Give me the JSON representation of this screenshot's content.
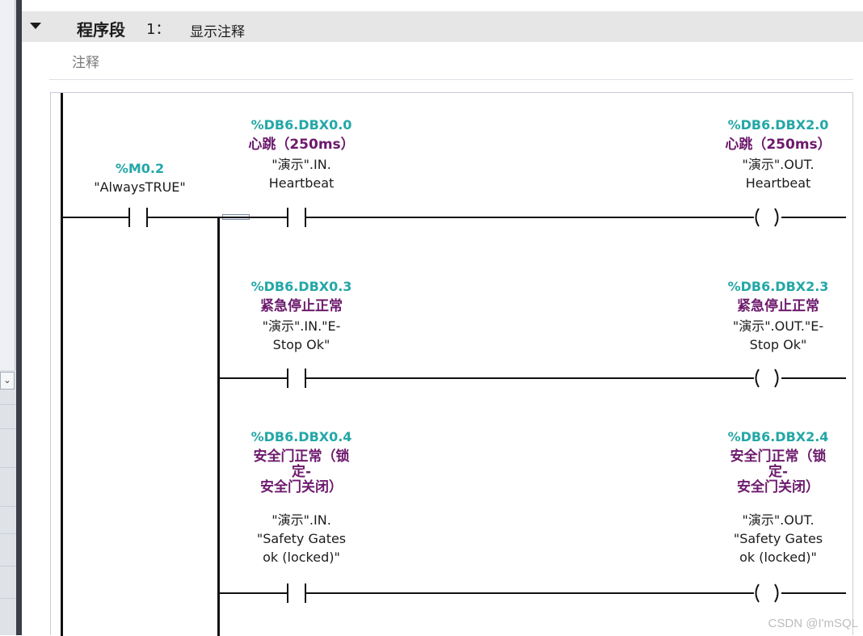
{
  "network": {
    "title": "程序段",
    "number": "1：",
    "name": "显示注释",
    "comment": "注释"
  },
  "rung": {
    "root": {
      "address": "%M0.2",
      "tag": "\"AlwaysTRUE\""
    },
    "branches": [
      {
        "contact": {
          "address": "%DB6.DBX0.0",
          "symbol": "心跳（250ms）",
          "tag": "\"演示\".IN.\nHeartbeat"
        },
        "coil": {
          "address": "%DB6.DBX2.0",
          "symbol": "心跳（250ms）",
          "tag": "\"演示\".OUT.\nHeartbeat"
        }
      },
      {
        "contact": {
          "address": "%DB6.DBX0.3",
          "symbol": "紧急停止正常",
          "tag": "\"演示\".IN.\"E-\nStop Ok\""
        },
        "coil": {
          "address": "%DB6.DBX2.3",
          "symbol": "紧急停止正常",
          "tag": "\"演示\".OUT.\"E-\nStop Ok\""
        }
      },
      {
        "contact": {
          "address": "%DB6.DBX0.4",
          "symbol": "安全门正常（锁\n定-\n安全门关闭）",
          "tag": "\"演示\".IN.\n\"Safety Gates\nok (locked)\""
        },
        "coil": {
          "address": "%DB6.DBX2.4",
          "symbol": "安全门正常（锁\n定-\n安全门关闭）",
          "tag": "\"演示\".OUT.\n\"Safety Gates\nok (locked)\""
        }
      }
    ]
  },
  "watermark": "CSDN @I'mSQL",
  "left_panel": {
    "dropdown_icon": "chevron-down-icon"
  },
  "colors": {
    "address": "#24a7a7",
    "symbol": "#6c1a6c",
    "header_bg": "#e6e6e6",
    "rail": "#111111"
  }
}
